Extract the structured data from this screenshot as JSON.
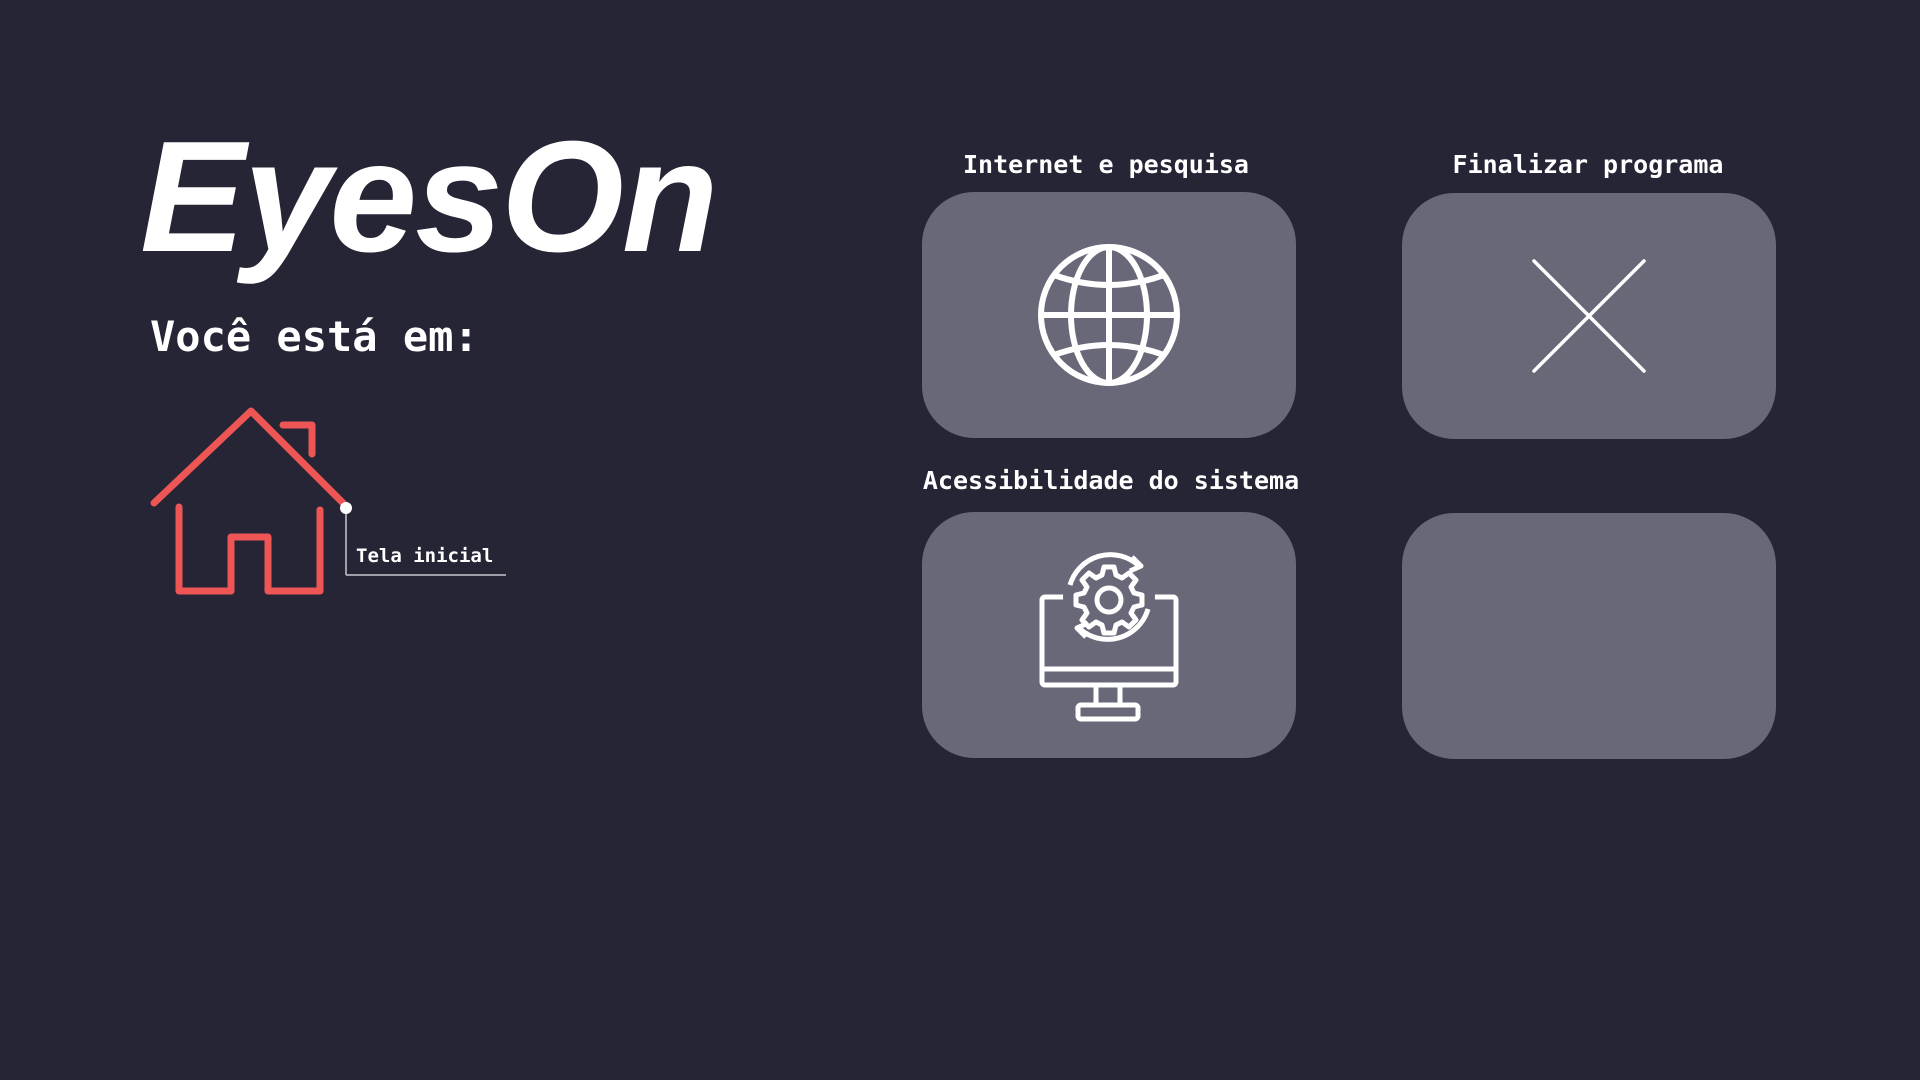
{
  "app": {
    "title": "EyesOn"
  },
  "location": {
    "label": "Você está em:",
    "current": "Tela inicial",
    "icon": "house-icon",
    "accent_color": "#ee5555"
  },
  "menu": {
    "tiles": [
      {
        "label": "Internet e pesquisa",
        "icon": "globe-icon"
      },
      {
        "label": "Finalizar programa",
        "icon": "close-icon"
      },
      {
        "label": "Acessibilidade do sistema",
        "icon": "system-settings-icon"
      },
      {
        "label": "",
        "icon": ""
      }
    ],
    "tile_color": "#686878",
    "background_color": "#252535"
  }
}
